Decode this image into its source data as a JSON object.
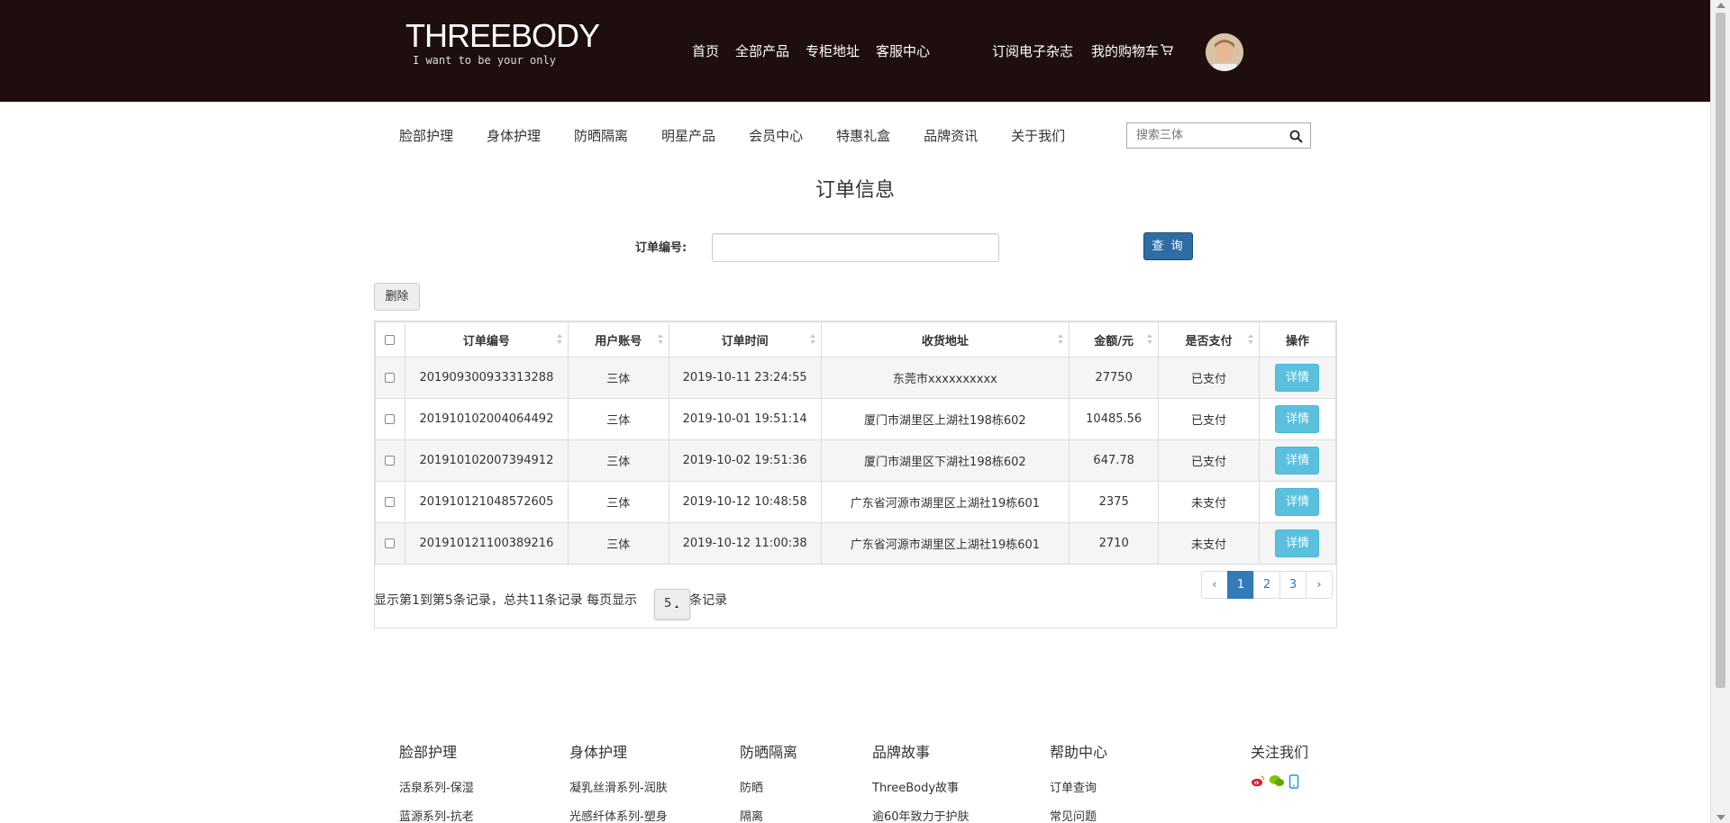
{
  "header": {
    "logo_main": "THREEBODY",
    "logo_sub": "I want to be your only",
    "nav": [
      "首页",
      "全部产品",
      "专柜地址",
      "客服中心"
    ],
    "nav_right": [
      "订阅电子杂志",
      "我的购物车"
    ]
  },
  "catnav": [
    "脸部护理",
    "身体护理",
    "防晒隔离",
    "明星产品",
    "会员中心",
    "特惠礼盒",
    "品牌资讯",
    "关于我们"
  ],
  "search": {
    "placeholder": "搜索三体"
  },
  "page_title": "订单信息",
  "query": {
    "label": "订单编号:",
    "value": "",
    "button": "查 询"
  },
  "delete_button": "删除",
  "table": {
    "columns": [
      "订单编号",
      "用户账号",
      "订单时间",
      "收货地址",
      "金额/元",
      "是否支付",
      "操作"
    ],
    "rows": [
      [
        "201909300933313288",
        "三体",
        "2019-10-11 23:24:55",
        "东莞市xxxxxxxxxx",
        "27750",
        "已支付",
        "详情"
      ],
      [
        "201910102004064492",
        "三体",
        "2019-10-01 19:51:14",
        "厦门市湖里区上湖社198栋602",
        "10485.56",
        "已支付",
        "详情"
      ],
      [
        "201910102007394912",
        "三体",
        "2019-10-02 19:51:36",
        "厦门市湖里区下湖社198栋602",
        "647.78",
        "已支付",
        "详情"
      ],
      [
        "201910121048572605",
        "三体",
        "2019-10-12 10:48:58",
        "广东省河源市湖里区上湖社19栋601",
        "2375",
        "未支付",
        "详情"
      ],
      [
        "201910121100389216",
        "三体",
        "2019-10-12 11:00:38",
        "广东省河源市湖里区上湖社19栋601",
        "2710",
        "未支付",
        "详情"
      ]
    ]
  },
  "pager": {
    "info_prefix": "显示第1到第5条记录，总共11条记录 每页显示",
    "page_size": "5",
    "info_suffix": "条记录",
    "prev": "‹",
    "pages": [
      "1",
      "2",
      "3"
    ],
    "next": "›",
    "active_page": "1"
  },
  "footer": {
    "col1": {
      "title": "脸部护理",
      "items": [
        "活泉系列-保湿",
        "蓝源系列-抗老"
      ]
    },
    "col2": {
      "title": "身体护理",
      "items": [
        "凝乳丝滑系列-润肤",
        "光感纤体系列-塑身"
      ]
    },
    "col3": {
      "title": "防晒隔离",
      "items": [
        "防晒",
        "隔离"
      ]
    },
    "col4": {
      "title": "品牌故事",
      "items": [
        "ThreeBody故事",
        "逾60年致力于护肤"
      ]
    },
    "col5": {
      "title": "帮助中心",
      "items": [
        "订单查询",
        "常见问题"
      ]
    },
    "col6": {
      "title": "关注我们"
    }
  },
  "icons": [
    "cart-icon",
    "search-icon",
    "weibo-icon",
    "wechat-icon",
    "mobile-icon"
  ],
  "colors": {
    "header_bg": "#1e0e0e",
    "primary": "#2e6da4",
    "info": "#5bc0de",
    "active_page": "#337ab7"
  }
}
